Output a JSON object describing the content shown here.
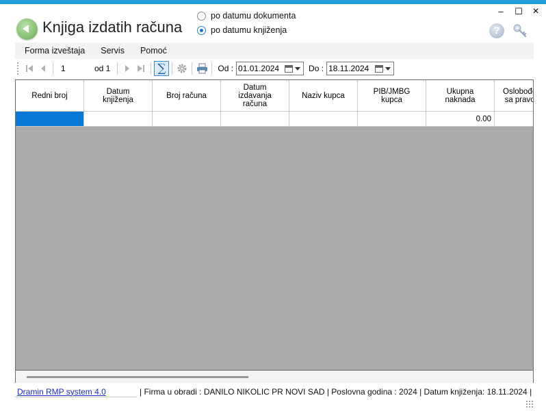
{
  "window": {
    "title": "Knjiga izdatih računa",
    "controls": {
      "minimize": "–",
      "maximize": "☐",
      "close": "×"
    }
  },
  "date_mode": {
    "options": [
      {
        "label": "po datumu dokumenta",
        "selected": false
      },
      {
        "label": "po datumu knjiženja",
        "selected": true
      }
    ]
  },
  "menu": {
    "items": [
      "Forma izveštaja",
      "Servis",
      "Pomoć"
    ]
  },
  "toolbar": {
    "page_value": "1",
    "page_total": "od 1",
    "sigma": "∑",
    "from_label": "Od :",
    "from_date": "01.01.2024",
    "to_label": "Do :",
    "to_date": "18.11.2024"
  },
  "grid": {
    "columns": [
      "Redni broj",
      "Datum\nknjiženja",
      "Broj računa",
      "Datum\nizdavanja\nračuna",
      "Naziv kupca",
      "PIB/JMBG\nkupca",
      "Ukupna\nnaknada",
      "Oslobođe\nsa pravo"
    ],
    "rows": [
      [
        "",
        "",
        "",
        "",
        "",
        "",
        "0.00",
        ""
      ]
    ]
  },
  "status": {
    "link": "Dramin RMP system 4.0",
    "info": "|  Firma u obradi : DANILO NIKOLIC PR NOVI SAD  |  Poslovna godina : 2024  |  Datum knjiženja: 18.11.2024  |"
  },
  "colors": {
    "accent": "#1e9fd8",
    "selection": "#0a78d7",
    "grid_background": "#ababab"
  },
  "icons": {
    "back": "back-arrow-icon",
    "help": "help-icon",
    "keys": "keys-icon",
    "settings": "gear-icon",
    "print": "printer-icon",
    "calendar": "calendar-icon"
  }
}
